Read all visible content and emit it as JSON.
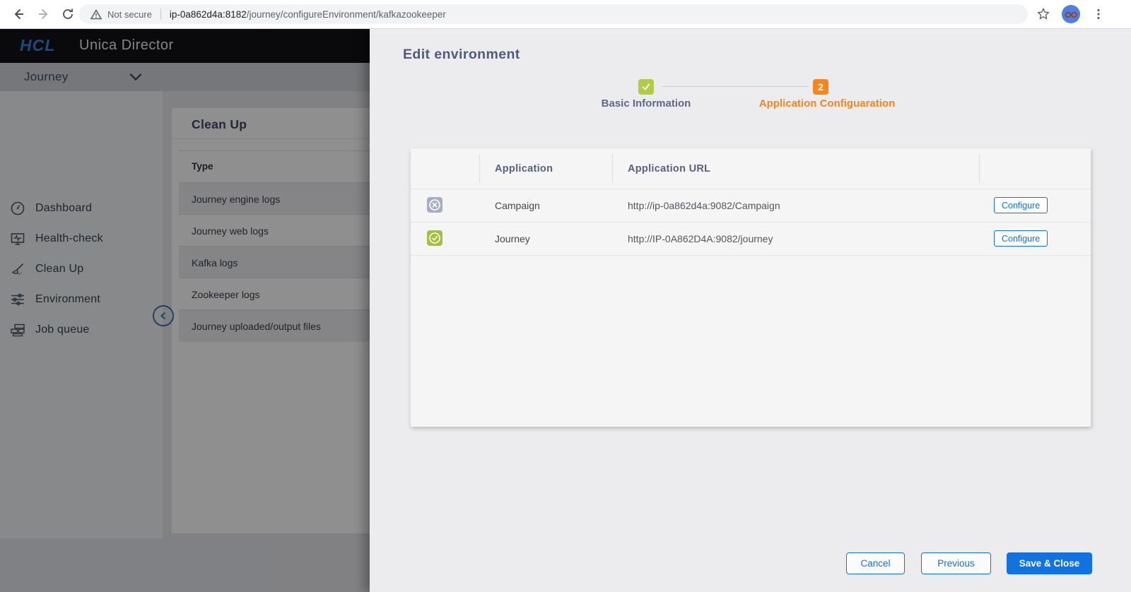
{
  "browser": {
    "security_label": "Not secure",
    "url_host": "ip-0a862d4a:8182",
    "url_path": "/journey/configureEnvironment/kafkazookeeper"
  },
  "header": {
    "brand": "HCL",
    "product": "Unica Director"
  },
  "nav": {
    "product_selector": "Journey"
  },
  "sidebar": {
    "items": [
      {
        "label": "Dashboard",
        "icon": "gauge"
      },
      {
        "label": "Health-check",
        "icon": "monitor-pulse"
      },
      {
        "label": "Clean Up",
        "icon": "broom"
      },
      {
        "label": "Environment",
        "icon": "sliders"
      },
      {
        "label": "Job queue",
        "icon": "queue"
      }
    ]
  },
  "cleanup": {
    "title": "Clean Up",
    "column_header": "Type",
    "rows": [
      "Journey engine logs",
      "Journey web logs",
      "Kafka logs",
      "Zookeeper logs",
      "Journey uploaded/output files"
    ]
  },
  "modal": {
    "title": "Edit environment",
    "steps": [
      {
        "label": "Basic Information",
        "state": "done"
      },
      {
        "label": "Application Configuaration",
        "state": "active",
        "number": "2"
      }
    ],
    "table": {
      "headers": {
        "application": "Application",
        "application_url": "Application URL"
      },
      "rows": [
        {
          "application": "Campaign",
          "url": "http://ip-0a862d4a:9082/Campaign",
          "status": "not-configured",
          "action_label": "Configure"
        },
        {
          "application": "Journey",
          "url": "http://IP-0A862D4A:9082/journey",
          "status": "configured",
          "action_label": "Configure"
        }
      ]
    },
    "footer": {
      "cancel_label": "Cancel",
      "previous_label": "Previous",
      "save_label": "Save & Close"
    }
  },
  "colors": {
    "accent_blue": "#1273de",
    "step_green": "#b3ca48",
    "step_orange": "#f2861f",
    "status_grey": "#a9adc4",
    "status_green": "#a4c03c"
  }
}
